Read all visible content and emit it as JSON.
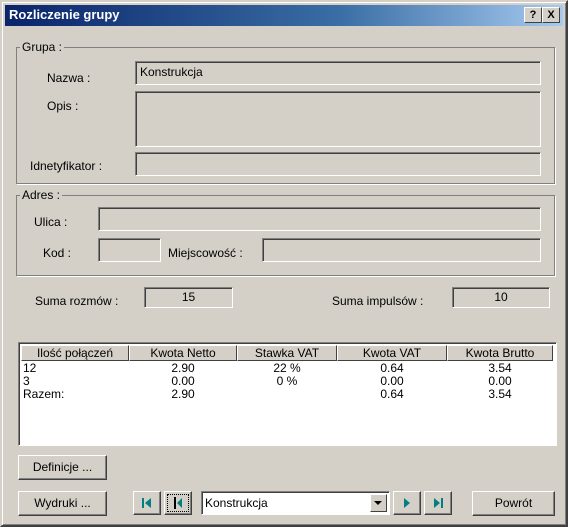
{
  "window": {
    "title": "Rozliczenie grupy",
    "help_label": "?",
    "close_label": "X"
  },
  "grupa": {
    "legend": "Grupa :",
    "nazwa_label": "Nazwa :",
    "nazwa_value": "Konstrukcja",
    "opis_label": "Opis :",
    "opis_value": "",
    "identyfikator_label": "Idnetyfikator :",
    "identyfikator_value": ""
  },
  "adres": {
    "legend": "Adres :",
    "ulica_label": "Ulica :",
    "ulica_value": "",
    "kod_label": "Kod :",
    "kod_value": "",
    "miejscowosc_label": "Miejscowość :",
    "miejscowosc_value": ""
  },
  "summary": {
    "suma_rozmow_label": "Suma rozmów :",
    "suma_rozmow_value": "15",
    "suma_impulsow_label": "Suma impulsów :",
    "suma_impulsow_value": "10"
  },
  "table": {
    "columns": [
      "Ilość połączeń",
      "Kwota Netto",
      "Stawka VAT",
      "Kwota VAT",
      "Kwota Brutto"
    ],
    "rows": [
      [
        "12",
        "2.90",
        "22 %",
        "0.64",
        "3.54"
      ],
      [
        "3",
        "0.00",
        "0 %",
        "0.00",
        "0.00"
      ],
      [
        "Razem:",
        "2.90",
        "",
        "0.64",
        "3.54"
      ]
    ]
  },
  "buttons": {
    "definicje": "Definicje ...",
    "wydruki": "Wydruki ...",
    "powrot": "Powrót"
  },
  "navigator": {
    "selected": "Konstrukcja"
  },
  "colors": {
    "titlebar_start": "#0a246a",
    "titlebar_end": "#a6caf0",
    "face": "#d4d0c8",
    "nav_arrow": "#008080"
  }
}
